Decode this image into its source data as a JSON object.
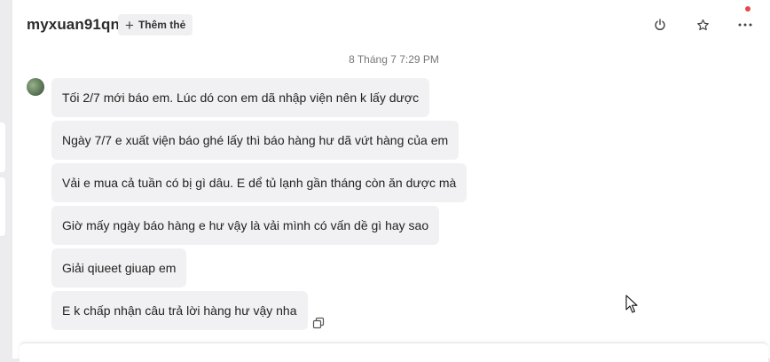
{
  "header": {
    "username": "myxuan91qn",
    "add_tag_label": "Thêm thẻ",
    "icons": [
      "power-icon",
      "star-icon",
      "more-icon"
    ]
  },
  "conversation": {
    "timestamp": "8 Tháng 7 7:29 PM",
    "messages": [
      "Tối 2/7 mới báo em. Lúc dó con em dã nhập viện nên k lấy dược",
      "Ngày 7/7 e xuất viện báo ghé lấy thì báo hàng hư dã vứt hàng của em",
      "Vải e mua cả tuần có bị gì dâu. E dể tủ lạnh gần tháng còn ăn dược mà",
      "Giờ mấy ngày báo hàng e hư vậy là vải mình có vấn dề gì hay sao",
      "Giải qiueet giuap em",
      "E k chấp nhận câu trả lời hàng hư vậy nha"
    ]
  },
  "colors": {
    "bubble_bg": "#f1f1f3",
    "notification_dot": "#e8474a"
  }
}
